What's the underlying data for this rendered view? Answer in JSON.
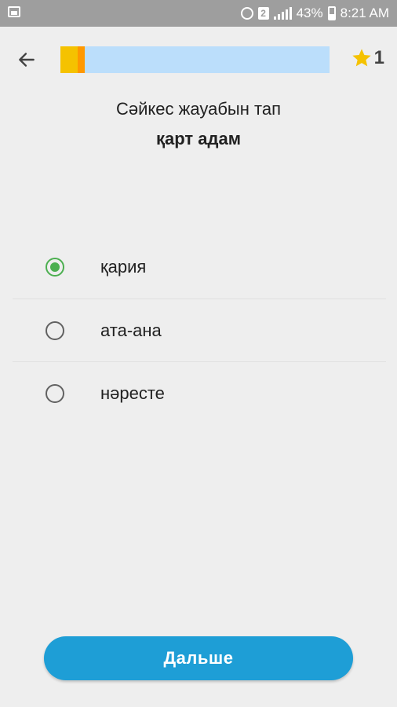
{
  "status_bar": {
    "battery": "43%",
    "time": "8:21 AM",
    "sim": "2"
  },
  "header": {
    "progress_fraction": 0.09,
    "score": "1"
  },
  "question": {
    "prompt": "Сәйкес жауабын тап",
    "word": "қарт адам"
  },
  "options": [
    {
      "label": "қария",
      "selected": true
    },
    {
      "label": "ата-ана",
      "selected": false
    },
    {
      "label": "нәресте",
      "selected": false
    }
  ],
  "footer": {
    "next_label": "Дальше"
  },
  "colors": {
    "accent": "#1e9ed6",
    "progress_track": "#bbdefb",
    "progress_fill": "#f5c200",
    "star": "#f5c200",
    "selected": "#4caf50"
  }
}
